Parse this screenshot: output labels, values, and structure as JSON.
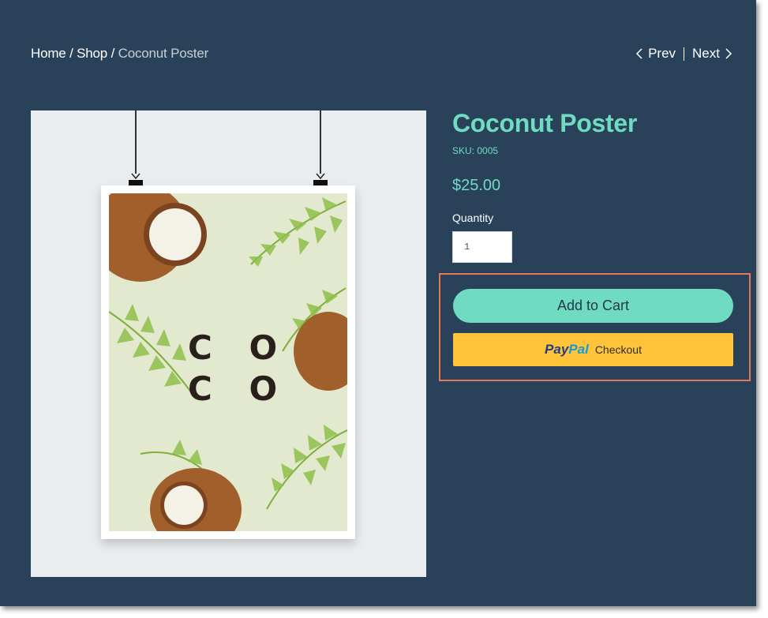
{
  "breadcrumb": {
    "home": "Home",
    "separator": "/",
    "shop": "Shop",
    "current": "Coconut Poster"
  },
  "pager": {
    "prev": "Prev",
    "next": "Next"
  },
  "product": {
    "title": "Coconut Poster",
    "sku": "SKU: 0005",
    "price": "$25.00",
    "quantity_label": "Quantity",
    "quantity_value": "1",
    "image_text_line1": "C O",
    "image_text_line2": "C O"
  },
  "actions": {
    "add_to_cart": "Add to Cart",
    "paypal_brand_1": "Pay",
    "paypal_brand_2": "Pal",
    "paypal_checkout": "Checkout"
  },
  "colors": {
    "background": "#2a4259",
    "accent": "#6fdcc2",
    "paypal": "#ffc439",
    "highlight": "#e8765a"
  }
}
